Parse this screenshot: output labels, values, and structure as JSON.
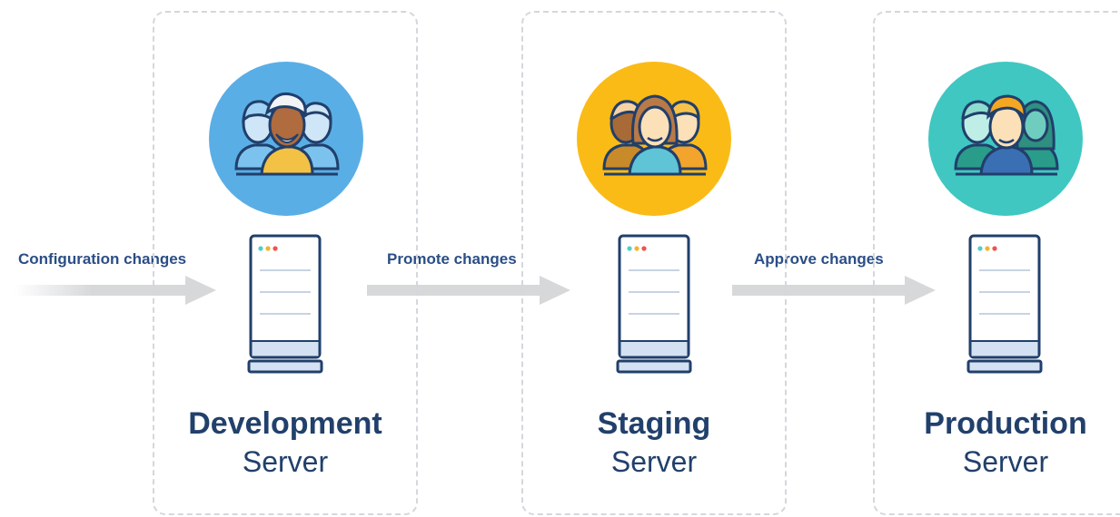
{
  "stages": [
    {
      "title": "Development",
      "subtitle": "Server",
      "avatar_color": "#5aaee6",
      "icon": "developer-team-icon"
    },
    {
      "title": "Staging",
      "subtitle": "Server",
      "avatar_color": "#fbbb16",
      "icon": "tester-team-icon"
    },
    {
      "title": "Production",
      "subtitle": "Server",
      "avatar_color": "#40c7c2",
      "icon": "operations-team-icon"
    }
  ],
  "flows": [
    {
      "label": "Configuration changes"
    },
    {
      "label": "Promote changes"
    },
    {
      "label": "Approve changes"
    }
  ],
  "colors": {
    "text_dark": "#21406b",
    "flow_label": "#2a4e86",
    "arrow": "#d7d8da",
    "dashed_border": "#d4d7dc",
    "server_outline": "#213f6b",
    "server_base": "#d4e1f2"
  }
}
